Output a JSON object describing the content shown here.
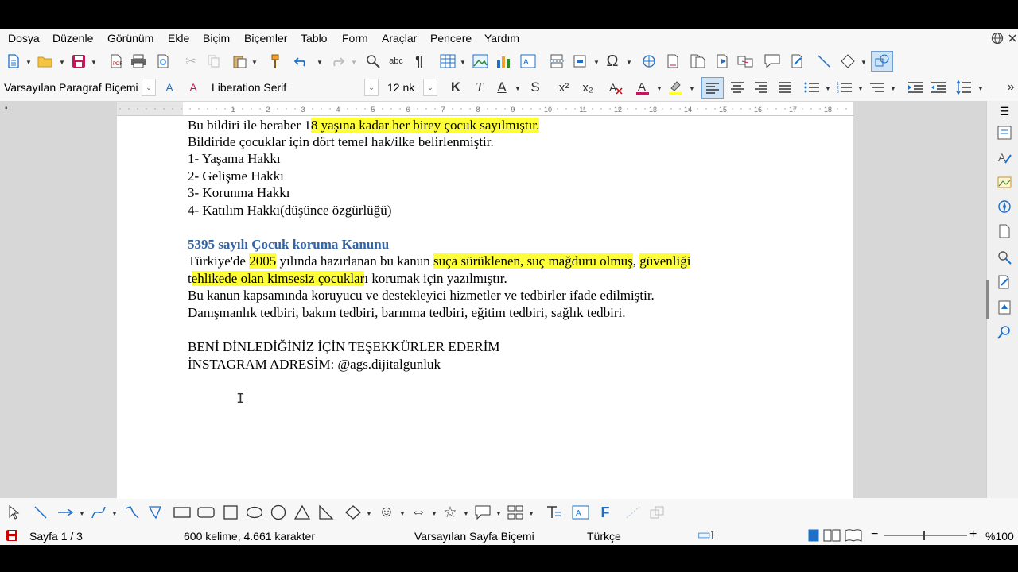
{
  "menu": {
    "items": [
      "Dosya",
      "Düzenle",
      "Görünüm",
      "Ekle",
      "Biçim",
      "Biçemler",
      "Tablo",
      "Form",
      "Araçlar",
      "Pencere",
      "Yardım"
    ]
  },
  "format": {
    "paragraph_style": "Varsayılan Paragraf Biçemi",
    "font_name": "Liberation Serif",
    "font_size": "12 nk",
    "bold": "K",
    "italic": "T",
    "underline": "A",
    "strike": "S",
    "superscript": "x²",
    "subscript": "x₂"
  },
  "document": {
    "lines": [
      {
        "pre": "Bu bildiri ile beraber 1",
        "hl": "8 yaşına kadar her birey çocuk sayılmıştır.",
        "post": ""
      },
      {
        "text": "Bildiride çocuklar için dört temel hak/ilke belirlenmiştir."
      },
      {
        "text": "1- Yaşama Hakkı"
      },
      {
        "text": "2- Gelişme Hakkı"
      },
      {
        "text": "3- Korunma Hakkı"
      },
      {
        "text": "4- Katılım Hakkı(düşünce özgürlüğü)"
      }
    ],
    "heading": "5395 sayılı Çocuk koruma Kanunu",
    "law_line1": {
      "a": "Türkiye'de ",
      "b": "2005",
      "c": " yılında hazırlanan bu kanun ",
      "d": "suça sürüklenen, suç mağduru olmuş",
      "e": ", ",
      "f": "güvenliği"
    },
    "law_line2": {
      "a": "t",
      "b": "ehlikede olan kimsesiz çocuklar",
      "c": "ı korumak için yazılmıştır."
    },
    "law_line3": "Bu kanun kapsamında koruyucu ve destekleyici hizmetler ve tedbirler ifade edilmiştir.",
    "law_line4": "Danışmanlık tedbiri, bakım tedbiri, barınma tedbiri, eğitim tedbiri, sağlık tedbiri.",
    "thanks": "BENİ DİNLEDİĞİNİZ İÇİN TEŞEKKÜRLER EDERİM",
    "instagram": "İNSTAGRAM ADRESİM: @ags.dijitalgunluk"
  },
  "ruler": {
    "ticks": [
      "1",
      "2",
      "3",
      "4",
      "5",
      "6",
      "7",
      "8",
      "9",
      "10",
      "11",
      "12",
      "13",
      "14",
      "15",
      "16",
      "17",
      "18"
    ]
  },
  "status": {
    "page": "Sayfa 1 / 3",
    "words": "600 kelime, 4.661 karakter",
    "page_style": "Varsayılan Sayfa Biçemi",
    "language": "Türkçe",
    "zoom": "%100"
  },
  "colors": {
    "highlight": "#ffff38",
    "heading": "#3465a4",
    "accent": "#1e6fc8"
  }
}
